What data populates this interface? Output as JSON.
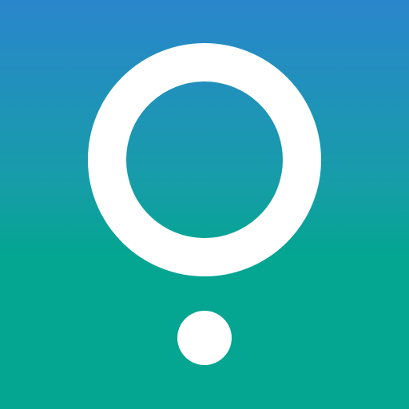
{
  "icon": {
    "semantic": "pin-marker-icon",
    "colors": {
      "gradient_top": "#2a86cc",
      "gradient_mid": "#169da8",
      "gradient_bottom": "#04a591",
      "glyph": "#ffffff"
    }
  }
}
